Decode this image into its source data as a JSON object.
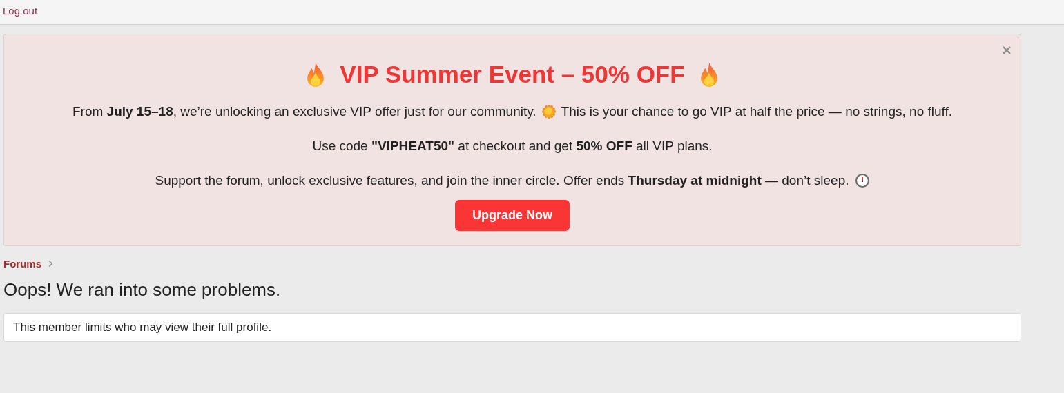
{
  "top_bar": {
    "link": "Log out"
  },
  "banner": {
    "title": "VIP Summer Event – 50% OFF",
    "closable": true,
    "paragraphs": [
      {
        "parts": [
          {
            "kind": "text",
            "text": "From **July 15–18**, we’re unlocking an exclusive VIP offer just for our community."
          },
          {
            "kind": "sun"
          },
          {
            "kind": "text",
            "text": "This is your chance to go VIP at half the price — no strings, no fluff."
          }
        ]
      },
      {
        "parts": [
          {
            "kind": "text",
            "text": "Use code **\"VIPHEAT50\"** at checkout and get **50% OFF** all VIP plans."
          }
        ]
      },
      {
        "parts": [
          {
            "kind": "text",
            "text": "Support the forum, unlock exclusive features, and join the inner circle. Offer ends **Thursday at midnight** — don’t sleep."
          },
          {
            "kind": "clock"
          }
        ]
      }
    ],
    "button": "Upgrade Now"
  },
  "breadcrumb": [
    {
      "label": "Forums"
    }
  ],
  "heading": "Oops! We ran into some problems.",
  "message": "This member limits who may view their full profile."
}
